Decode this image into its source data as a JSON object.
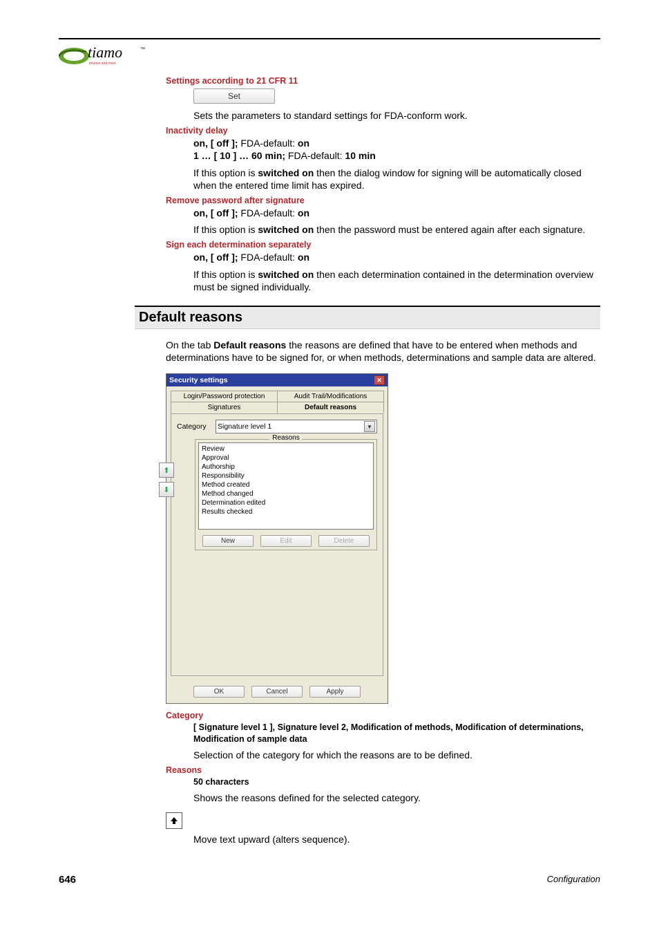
{
  "sections": {
    "cfr_heading": "Settings according to 21 CFR 11",
    "set_button": "Set",
    "set_desc": "Sets the parameters to standard settings for FDA-conform work.",
    "inactivity": {
      "title": "Inactivity delay",
      "opts1a": "on, [ off ];",
      "opts1b": " FDA-default: ",
      "opts1c": "on",
      "opts2a": "1 … [ 10 ] … 60 min;",
      "opts2b": " FDA-default: ",
      "opts2c": "10 min",
      "desc1": "If this option is ",
      "desc1b": "switched on",
      "desc1c": " then the dialog window for signing will be automatically closed when the entered time limit has expired."
    },
    "remove": {
      "title": "Remove password after signature",
      "opts1a": "on, [ off ];",
      "opts1b": " FDA-default: ",
      "opts1c": "on",
      "desc1": "If this option is ",
      "desc1b": "switched on",
      "desc1c": " then the password must be entered again after each signature."
    },
    "sign": {
      "title": "Sign each determination separately",
      "opts1a": "on, [ off ];",
      "opts1b": " FDA-default: ",
      "opts1c": "on",
      "desc1": "If this option is ",
      "desc1b": "switched on",
      "desc1c": " then each determination contained in the determination overview must be signed individually."
    }
  },
  "default_reasons": {
    "heading": "Default reasons",
    "intro1": "On the tab ",
    "intro_bold": "Default reasons",
    "intro2": " the reasons are defined that have to be entered when methods and determinations have to be signed for, or when methods, determinations and sample data are altered."
  },
  "dialog": {
    "title": "Security settings",
    "tabs": {
      "login": "Login/Password protection",
      "audit": "Audit Trail/Modifications",
      "signatures": "Signatures",
      "default": "Default reasons"
    },
    "category_label": "Category",
    "category_value": "Signature level 1",
    "reasons_label": "Reasons",
    "reasons": [
      "Review",
      "Approval",
      "Authorship",
      "Responsibility",
      "Method created",
      "Method changed",
      "Determination edited",
      "Results checked"
    ],
    "btn_new": "New",
    "btn_edit": "Edit",
    "btn_delete": "Delete",
    "btn_ok": "OK",
    "btn_cancel": "Cancel",
    "btn_apply": "Apply"
  },
  "defs": {
    "category_title": "Category",
    "category_opts": "[ Signature level 1 ], Signature level 2, Modification of methods, Modification of determinations, Modification of sample data",
    "category_desc": "Selection of the category for which the reasons are to be defined.",
    "reasons_title": "Reasons",
    "reasons_opts": "50 characters",
    "reasons_desc": "Shows the reasons defined for the selected category.",
    "arrow_desc": "Move text upward (alters sequence)."
  },
  "footer": {
    "page": "646",
    "chapter": "Configuration"
  }
}
